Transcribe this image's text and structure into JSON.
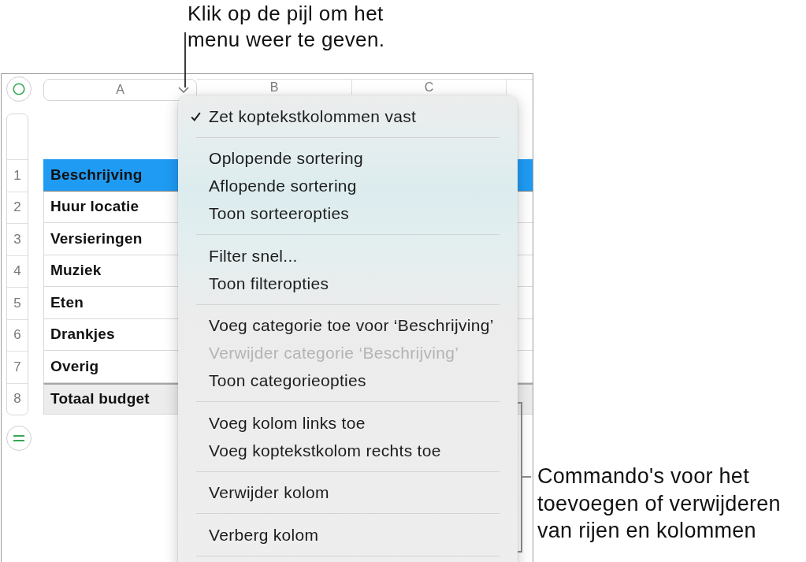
{
  "callouts": [
    {
      "kind": "line",
      "text": "Klik op de pijl om het menu weer te geven."
    },
    {
      "kind": "bracket",
      "text": "Commando's voor het toevoegen of verwijderen van rijen en kolommen"
    }
  ],
  "spreadsheet": {
    "columns": [
      {
        "label": "A",
        "selected": true
      },
      {
        "label": "B",
        "selected": false
      },
      {
        "label": "C",
        "selected": false
      }
    ],
    "rows": [
      {
        "number": "1",
        "label": "Beschrijving",
        "kind": "header"
      },
      {
        "number": "2",
        "label": "Huur locatie",
        "kind": "body"
      },
      {
        "number": "3",
        "label": "Versieringen",
        "kind": "body"
      },
      {
        "number": "4",
        "label": "Muziek",
        "kind": "body"
      },
      {
        "number": "5",
        "label": "Eten",
        "kind": "body"
      },
      {
        "number": "6",
        "label": "Drankjes",
        "kind": "body"
      },
      {
        "number": "7",
        "label": "Overig",
        "kind": "body"
      },
      {
        "number": "8",
        "label": "Totaal budget",
        "kind": "footer"
      }
    ]
  },
  "menu": {
    "groups": [
      {
        "items": [
          {
            "label": "Zet koptekstkolommen vast",
            "checked": true,
            "disabled": false
          }
        ]
      },
      {
        "items": [
          {
            "label": "Oplopende sortering",
            "checked": false,
            "disabled": false
          },
          {
            "label": "Aflopende sortering",
            "checked": false,
            "disabled": false
          },
          {
            "label": "Toon sorteeropties",
            "checked": false,
            "disabled": false
          }
        ]
      },
      {
        "items": [
          {
            "label": "Filter snel...",
            "checked": false,
            "disabled": false
          },
          {
            "label": "Toon filteropties",
            "checked": false,
            "disabled": false
          }
        ]
      },
      {
        "items": [
          {
            "label": "Voeg categorie toe voor ‘Beschrijving’",
            "checked": false,
            "disabled": false
          },
          {
            "label": "Verwijder categorie ‘Beschrijving’",
            "checked": false,
            "disabled": true
          },
          {
            "label": "Toon categorieopties",
            "checked": false,
            "disabled": false
          }
        ]
      },
      {
        "items": [
          {
            "label": "Voeg kolom links toe",
            "checked": false,
            "disabled": false
          },
          {
            "label": "Voeg koptekstkolom rechts toe",
            "checked": false,
            "disabled": false
          }
        ]
      },
      {
        "items": [
          {
            "label": "Verwijder kolom",
            "checked": false,
            "disabled": false
          }
        ]
      },
      {
        "items": [
          {
            "label": "Verberg kolom",
            "checked": false,
            "disabled": false
          }
        ]
      }
    ]
  }
}
